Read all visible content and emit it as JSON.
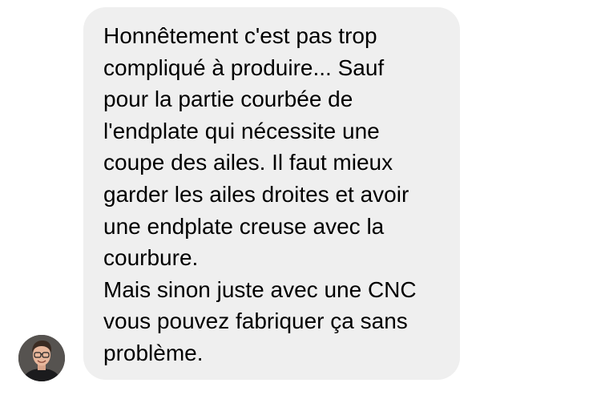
{
  "conversation": {
    "message": {
      "lines": [
        "Honnêtement c'est pas trop",
        "compliqué à produire... Sauf",
        "pour la partie courbée de",
        "l'endplate qui nécessite une",
        "coupe des ailes. Il faut mieux",
        "garder les ailes droites et avoir",
        "une endplate creuse avec la",
        "courbure.",
        "Mais sinon juste avec une CNC",
        "vous pouvez fabriquer ça sans",
        "problème."
      ]
    },
    "bubble_color": "#efefef",
    "text_color": "#000000"
  }
}
